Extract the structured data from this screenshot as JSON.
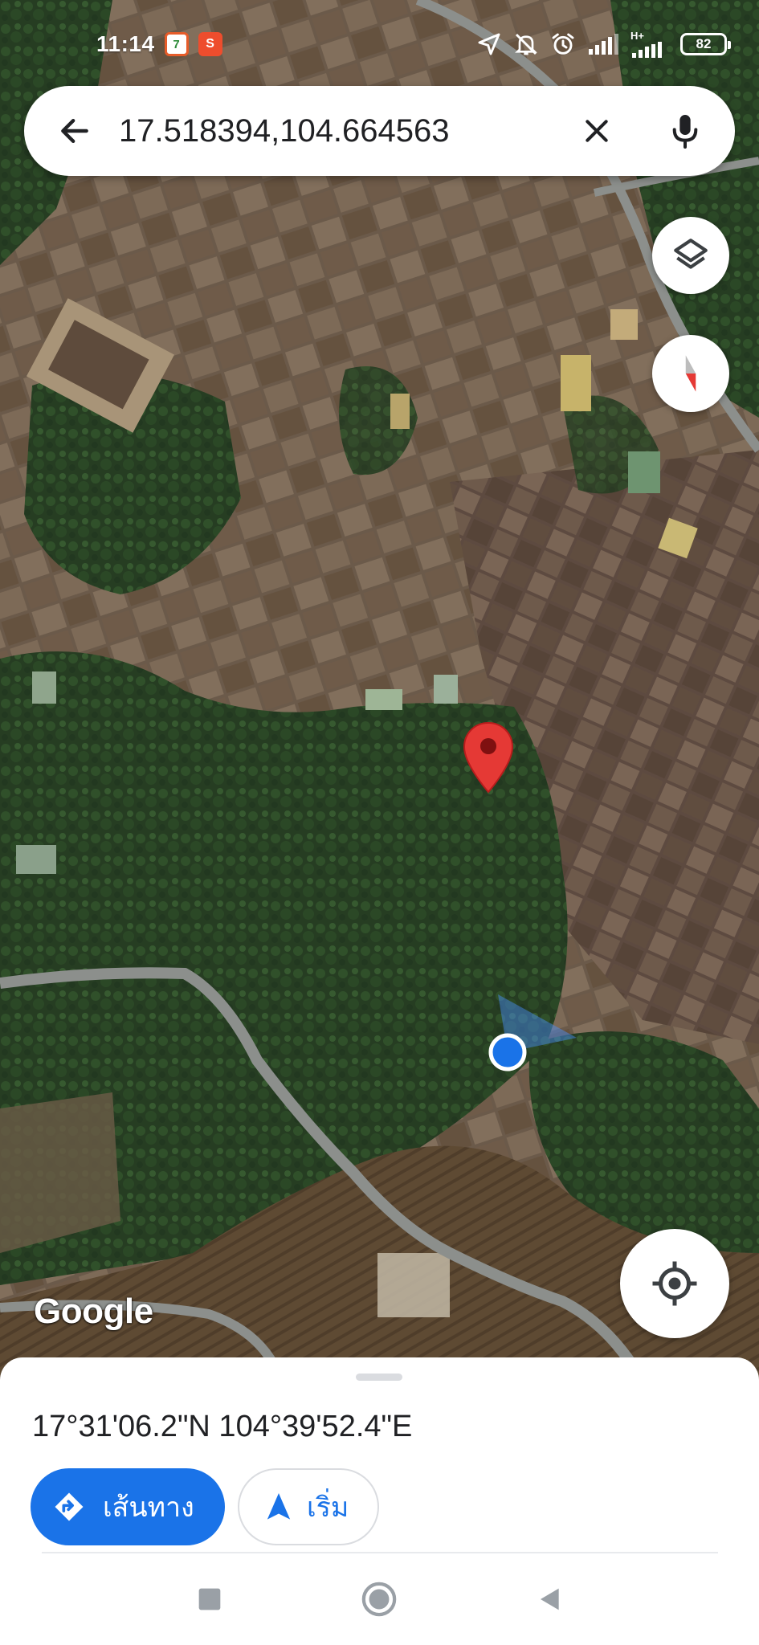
{
  "status_bar": {
    "time": "11:14",
    "apps": [
      {
        "name": "seven-eleven-app",
        "glyph": "7"
      },
      {
        "name": "shopee-app",
        "glyph": "S"
      }
    ],
    "network_label": "H+",
    "battery": "82"
  },
  "search": {
    "query": "17.518394,104.664563",
    "icons": {
      "back": "arrow-back-icon",
      "clear": "close-icon",
      "mic": "microphone-icon"
    }
  },
  "map": {
    "attribution": "Google",
    "pin_color": "#e53935",
    "my_location_color": "#1a73e8",
    "icons": {
      "layers": "layers-icon",
      "compass": "compass-icon",
      "locate": "my-location-icon"
    }
  },
  "sheet": {
    "coordinates": "17°31'06.2\"N 104°39'52.4\"E",
    "directions_label": "เส้นทาง",
    "start_label": "เริ่ม",
    "accent": "#1a73e8"
  },
  "nav_bar": {
    "icons": [
      "recents-square-icon",
      "home-circle-icon",
      "back-triangle-icon"
    ]
  }
}
